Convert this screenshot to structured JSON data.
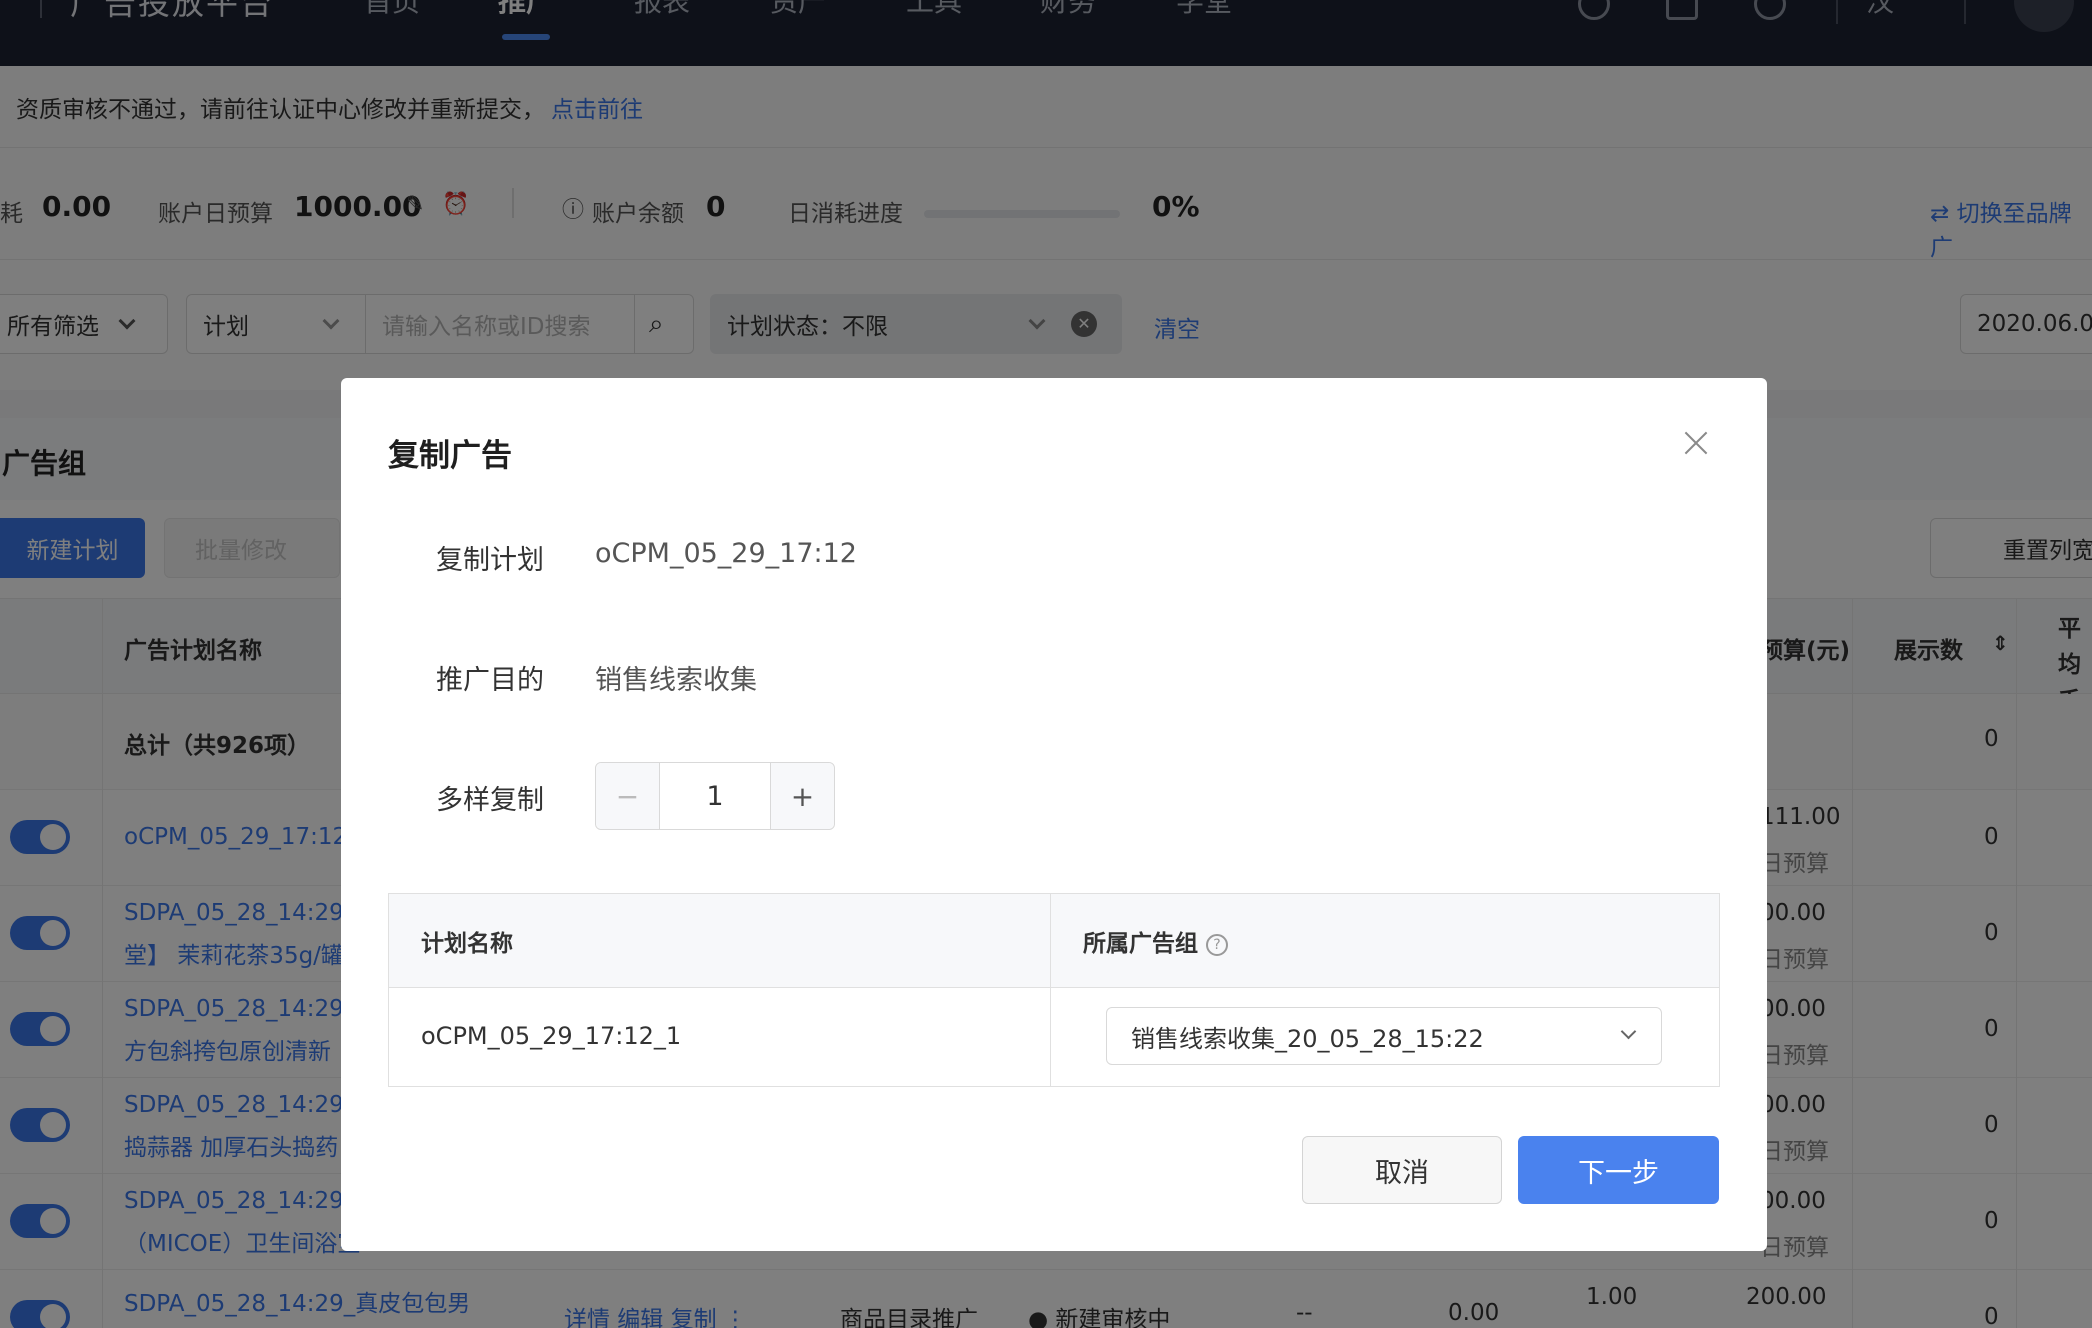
{
  "nav": {
    "brand": "广告投放平台",
    "items": [
      "首页",
      "推广",
      "报表",
      "资产",
      "工具",
      "财务",
      "学堂"
    ],
    "active_index": 1,
    "lang": "汉"
  },
  "alert": {
    "text": "资质审核不通过，请前往认证中心修改并重新提交，",
    "link": "点击前往"
  },
  "stats": {
    "spend_label": "耗",
    "spend_value": "0.00",
    "budget_label": "账户日预算",
    "budget_value": "1000.00",
    "balance_label": "账户余额",
    "balance_value": "0",
    "progress_label": "日消耗进度",
    "progress_value": "0%",
    "progress_fraction": 0,
    "switch_label": "切换至品牌广"
  },
  "filters": {
    "all_filter": "所有筛选",
    "level": "计划",
    "search_placeholder": "请输入名称或ID搜索",
    "status": "计划状态：不限",
    "clear": "清空",
    "date": "2020.06.0"
  },
  "section": {
    "title": "广告组",
    "new_button": "新建计划",
    "batch_button": "批量修改",
    "reset_button": "重置列宽"
  },
  "table": {
    "headers": [
      "广告计划名称",
      "预算(元)",
      "展示数",
      "平均千次展"
    ],
    "total_label": "总计（共926项）",
    "total_impressions": "0",
    "rows": [
      {
        "name": "oCPM_05_29_17:12",
        "name2": "",
        "budget": "111.00",
        "budget2": "日预算",
        "impressions": "0"
      },
      {
        "name": "SDPA_05_28_14:29",
        "name2": "堂】 茉莉花茶35g/罐",
        "budget": "00.00",
        "budget2": "日预算",
        "impressions": "0"
      },
      {
        "name": "SDPA_05_28_14:29",
        "name2": "方包斜挎包原创清新",
        "budget": "00.00",
        "budget2": "日预算",
        "impressions": "0"
      },
      {
        "name": "SDPA_05_28_14:29",
        "name2": "捣蒜器 加厚石头捣药",
        "budget": "00.00",
        "budget2": "日预算",
        "impressions": "0"
      },
      {
        "name": "SDPA_05_28_14:29",
        "name2": "（MICOE）卫生间浴室",
        "budget": "00.00",
        "budget2": "日预算",
        "impressions": "0"
      },
      {
        "name": "SDPA_05_28_14:29_真皮包包男",
        "name2": "",
        "budget": "200.00",
        "budget2": "",
        "impressions": "0"
      }
    ],
    "last_row_extra": {
      "actions": "详情  编辑  复制  ⋮",
      "type": "商品目录推广",
      "status": "新建审核中",
      "dash": "--",
      "cost": "0.00",
      "bid": "1.00"
    }
  },
  "modal": {
    "title": "复制广告",
    "copy_plan_label": "复制计划",
    "copy_plan_value": "oCPM_05_29_17:12",
    "purpose_label": "推广目的",
    "purpose_value": "销售线索收集",
    "multi_label": "多样复制",
    "multi_value": "1",
    "minus": "−",
    "plus": "+",
    "col_plan_name": "计划名称",
    "col_group": "所属广告组",
    "row_plan_name": "oCPM_05_29_17:12_1",
    "row_group": "销售线索收集_20_05_28_15:22",
    "cancel": "取消",
    "next": "下一步"
  },
  "colors": {
    "primary": "#3b77e8",
    "nav_bg": "#1c2233"
  }
}
